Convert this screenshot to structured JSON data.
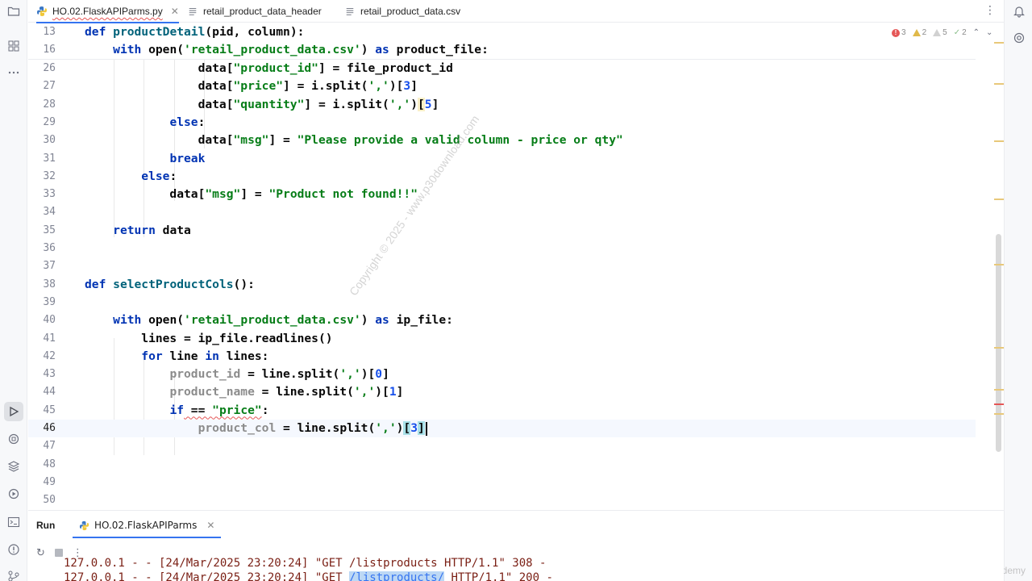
{
  "tabs": [
    {
      "label": "HO.02.FlaskAPIParms.py",
      "active": true,
      "icon": "python-icon"
    },
    {
      "label": "retail_product_data_header",
      "active": false,
      "icon": "text-file-icon"
    },
    {
      "label": "retail_product_data.csv",
      "active": false,
      "icon": "text-file-icon"
    }
  ],
  "inspections": {
    "errors": "3",
    "warnings": "2",
    "weak_warnings": "5",
    "typos": "2"
  },
  "editor": {
    "sticky_lines": [
      {
        "n": "13"
      },
      {
        "n": "16"
      }
    ],
    "lines": [
      {
        "n": "26"
      },
      {
        "n": "27"
      },
      {
        "n": "28"
      },
      {
        "n": "29"
      },
      {
        "n": "30"
      },
      {
        "n": "31"
      },
      {
        "n": "32"
      },
      {
        "n": "33"
      },
      {
        "n": "34"
      },
      {
        "n": "35"
      },
      {
        "n": "36"
      },
      {
        "n": "37"
      },
      {
        "n": "38"
      },
      {
        "n": "39"
      },
      {
        "n": "40"
      },
      {
        "n": "41"
      },
      {
        "n": "42"
      },
      {
        "n": "43"
      },
      {
        "n": "44"
      },
      {
        "n": "45"
      },
      {
        "n": "46"
      },
      {
        "n": "47"
      },
      {
        "n": "48"
      },
      {
        "n": "49"
      },
      {
        "n": "50"
      }
    ],
    "current_line": "46"
  },
  "watermark": "Copyright © 2025 - www.p30download.com",
  "corner_mark": "Udemy",
  "run_panel": {
    "title": "Run",
    "tab_label": "HO.02.FlaskAPIParms",
    "console_line1": "127.0.0.1 - - [24/Mar/2025 23:20:24] \"GET /listproducts HTTP/1.1\" 308 -",
    "console_line2_prefix": "127.0.0.1 - - [24/Mar/2025 23:20:24] \"GET ",
    "console_line2_link": "/listproducts/",
    "console_line2_suffix": " HTTP/1.1\" 200 -"
  },
  "colors": {
    "accent": "#3574f0",
    "keyword": "#0033b3",
    "string": "#067d17",
    "function": "#00627a",
    "error": "#e55757"
  }
}
